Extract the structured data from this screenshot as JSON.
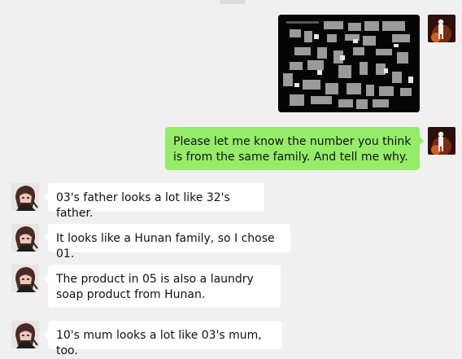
{
  "chat": {
    "messages": [
      {
        "side": "right",
        "type": "image",
        "alt": "Collage of numbered black-and-white family photos"
      },
      {
        "side": "right",
        "type": "text",
        "text": "Please let me know the number you think is from the same family. And tell me why."
      },
      {
        "side": "left",
        "type": "text",
        "text": "03's father looks a lot like 32's father."
      },
      {
        "side": "left",
        "type": "text",
        "text": "It looks like a Hunan family, so I chose 01."
      },
      {
        "side": "left",
        "type": "text",
        "text": "The product in 05 is also a laundry soap product from Hunan."
      },
      {
        "side": "left",
        "type": "text",
        "text": "10's mum looks a lot like 03's mum, too."
      }
    ]
  },
  "colors": {
    "background": "#f0f0f0",
    "incoming_bubble": "#ffffff",
    "outgoing_bubble": "#95ec69"
  },
  "icons": {
    "self_avatar": "person-silhouette-avatar",
    "contact_avatar": "anime-character-avatar"
  }
}
